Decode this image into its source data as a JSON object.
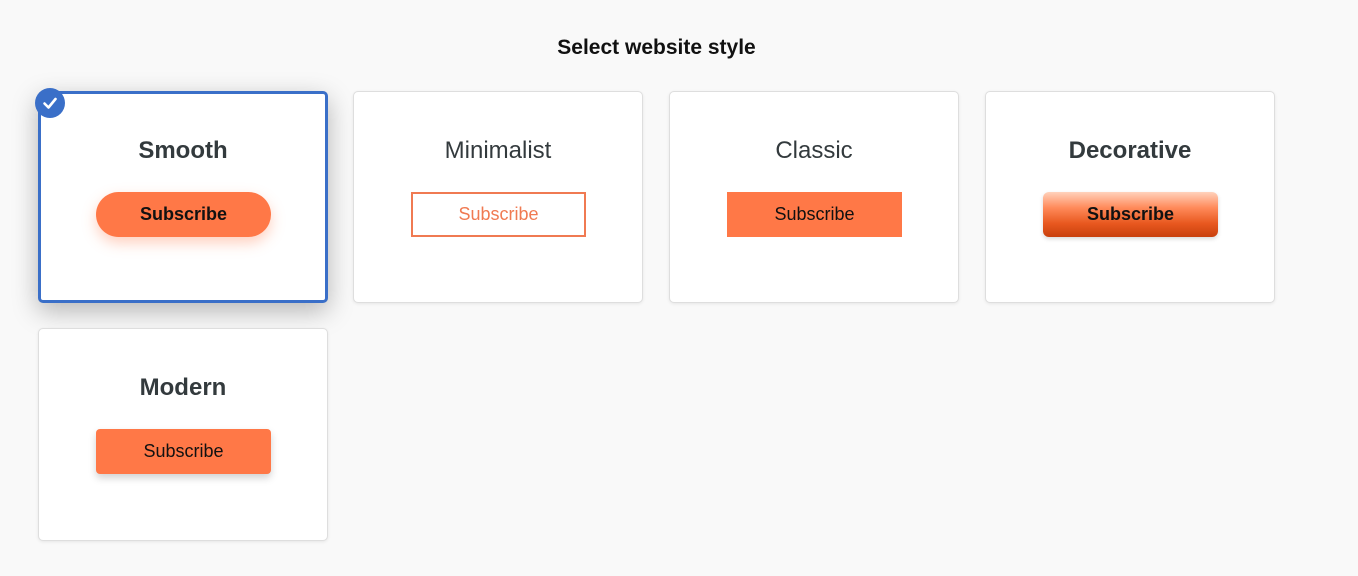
{
  "header": {
    "title": "Select website style"
  },
  "styles": [
    {
      "name": "Smooth",
      "button_label": "Subscribe",
      "selected": true
    },
    {
      "name": "Minimalist",
      "button_label": "Subscribe",
      "selected": false
    },
    {
      "name": "Classic",
      "button_label": "Subscribe",
      "selected": false
    },
    {
      "name": "Decorative",
      "button_label": "Subscribe",
      "selected": false
    },
    {
      "name": "Modern",
      "button_label": "Subscribe",
      "selected": false
    }
  ],
  "colors": {
    "accent": "#ff7847",
    "selection": "#3a6fc8",
    "background": "#f9f9f9",
    "card": "#ffffff"
  },
  "icons": {
    "selected_marker": "check-icon"
  }
}
